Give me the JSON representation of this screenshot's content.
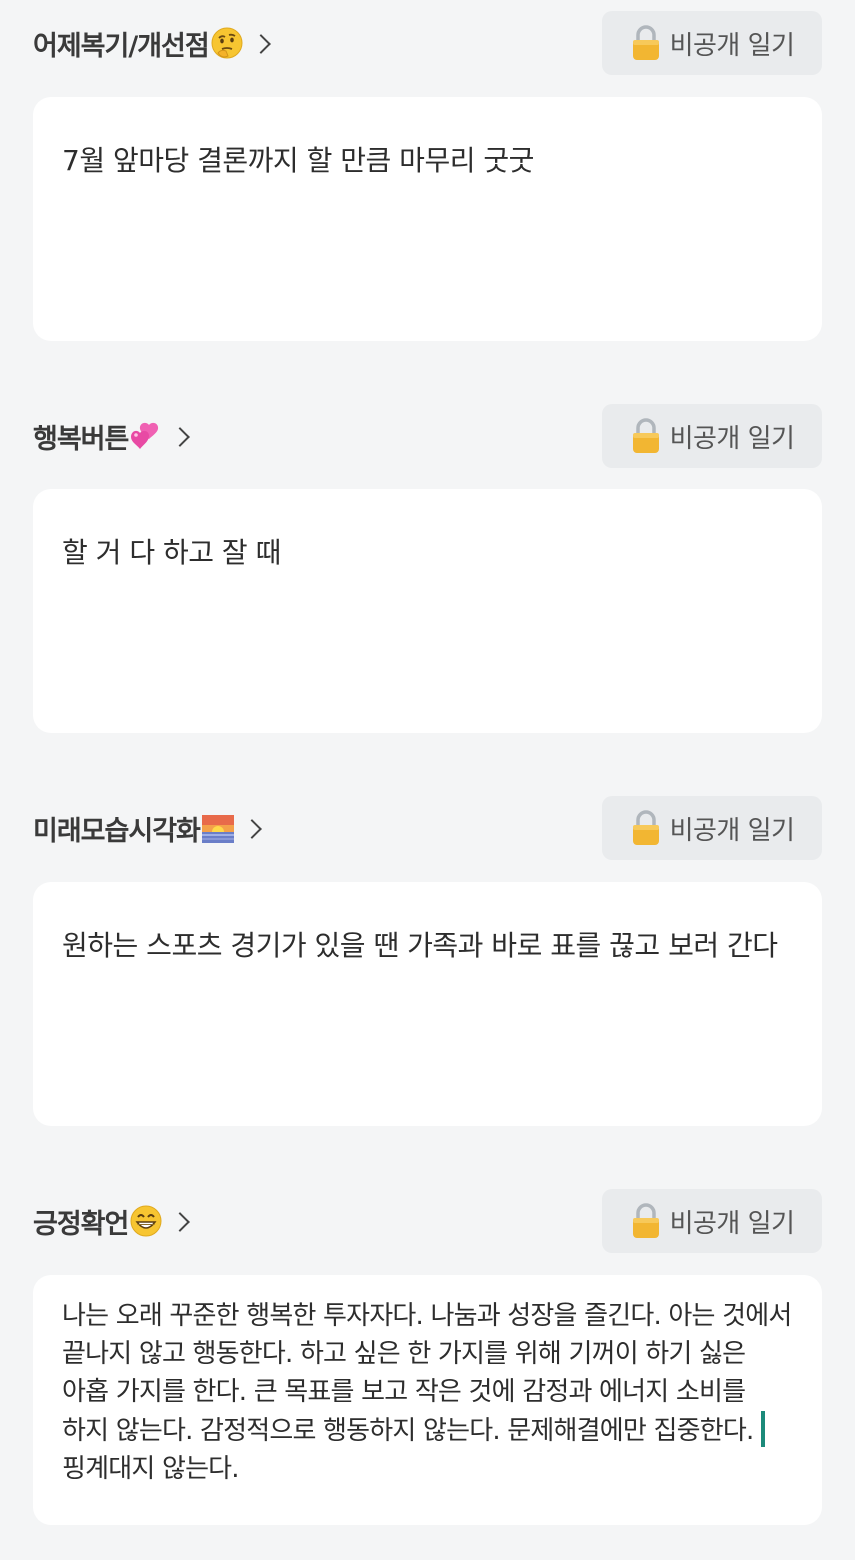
{
  "sections": [
    {
      "title": "어제복기/개선점",
      "emoji": "thinking-face-icon",
      "private_label": "비공개 일기",
      "content": "7월 앞마당 결론까지 할 만큼 마무리 굿굿"
    },
    {
      "title": "행복버튼",
      "emoji": "two-hearts-icon",
      "private_label": "비공개 일기",
      "content": "할 거 다 하고 잘 때"
    },
    {
      "title": "미래모습시각화",
      "emoji": "sunrise-icon",
      "private_label": "비공개 일기",
      "content": "원하는 스포츠 경기가 있을 땐 가족과 바로 표를 끊고 보러 간다"
    },
    {
      "title": "긍정확언",
      "emoji": "grinning-face-icon",
      "private_label": "비공개 일기",
      "content_before_caret": "나는 오래 꾸준한 행복한 투자자다. 나눔과 성장을 즐긴다. 아는 것에서 끝나지 않고 행동한다. 하고 싶은 한 가지를 위해 기꺼이 하기 싫은 아홉 가지를 한다. 큰 목표를 보고 작은 것에 감정과 에너지 소비를 하지 않는다. 감정적으로 행동하지 않는다. 문제해결에만 집중한다. ",
      "content_after_caret": "핑계대지 않는다."
    }
  ],
  "colors": {
    "background": "#f4f5f6",
    "card": "#ffffff",
    "private_button_bg": "#e9ebed",
    "caret": "#1c8a7a",
    "lock_gold": "#f2b632"
  }
}
